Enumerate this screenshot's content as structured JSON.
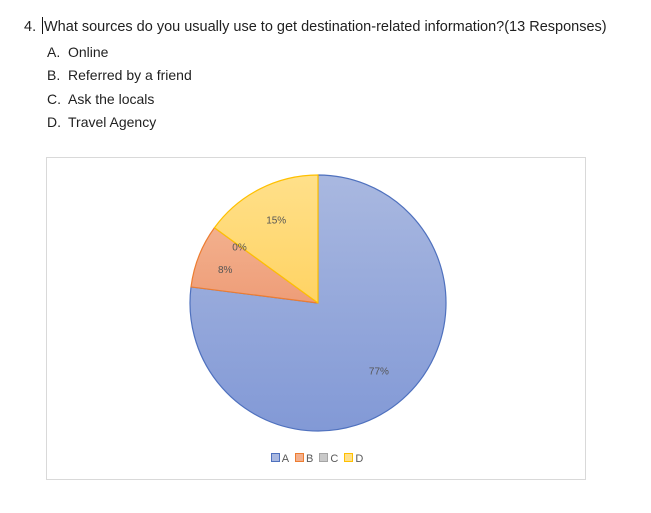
{
  "question": {
    "number": "4.",
    "text": "What sources do you usually use to get destination-related information?(13 Responses)",
    "options": [
      {
        "letter": "A.",
        "text": "Online"
      },
      {
        "letter": "B.",
        "text": "Referred by a friend"
      },
      {
        "letter": "C.",
        "text": "Ask the locals"
      },
      {
        "letter": "D.",
        "text": "Travel Agency"
      }
    ]
  },
  "chart_data": {
    "type": "pie",
    "title": "",
    "start_angle_deg": 0,
    "direction": "clockwise",
    "legend_position": "bottom",
    "slices": [
      {
        "label": "A",
        "value": 77,
        "display": "77%",
        "fill_top": "#a9b8e0",
        "fill_bottom": "#8299d6",
        "stroke": "#4f71be"
      },
      {
        "label": "B",
        "value": 8,
        "display": "8%",
        "fill_top": "#f3b08d",
        "fill_bottom": "#ee9d78",
        "stroke": "#ed7d31"
      },
      {
        "label": "C",
        "value": 0,
        "display": "0%",
        "fill_top": "#c9c9c9",
        "fill_bottom": "#b0b0b0",
        "stroke": "#a5a5a5"
      },
      {
        "label": "D",
        "value": 15,
        "display": "15%",
        "fill_top": "#ffe08a",
        "fill_bottom": "#ffd363",
        "stroke": "#ffc000"
      }
    ]
  }
}
